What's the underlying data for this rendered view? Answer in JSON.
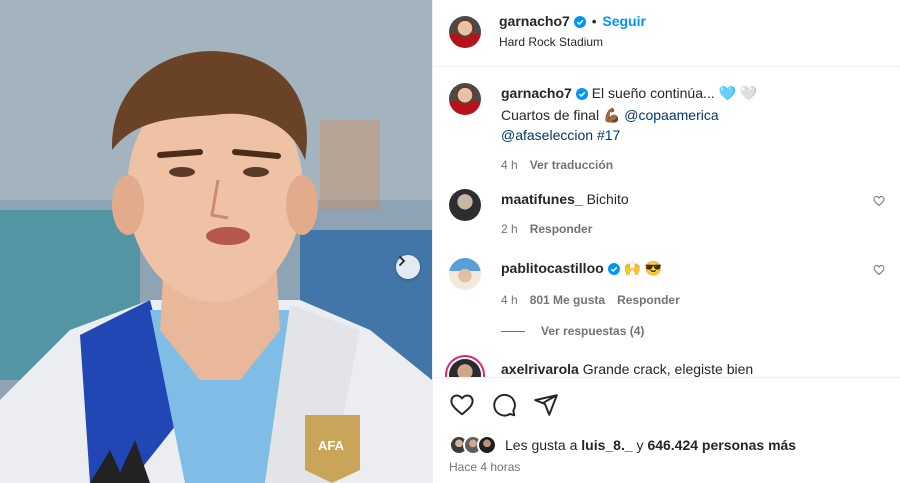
{
  "header": {
    "username": "garnacho7",
    "follow_label": "Seguir",
    "location": "Hard Rock Stadium"
  },
  "caption": {
    "username": "garnacho7",
    "line1": "El sueño continúa... 🩵 🤍",
    "line2_text": "Cuartos de final 💪🏾 ",
    "line2_tag": "@copaamerica",
    "line3_tag": "@afaseleccion",
    "line3_hashtag": "#17",
    "time": "4 h",
    "translate_label": "Ver traducción"
  },
  "comments": [
    {
      "username": "maatifunes_",
      "text": "Bichito",
      "time": "2 h",
      "reply_label": "Responder"
    },
    {
      "username": "pablitocastilloo",
      "text": "🙌 😎",
      "time": "4 h",
      "likes": "801 Me gusta",
      "reply_label": "Responder",
      "view_replies": "Ver respuestas (4)"
    },
    {
      "username": "axelrivarola",
      "text": "Grande crack, elegiste bien"
    }
  ],
  "footer": {
    "likes_prefix": "Les gusta a ",
    "likes_user": "luis_8._",
    "likes_mid": " y ",
    "likes_count": "646.424 personas más",
    "timestamp": "Hace 4 horas"
  },
  "icons": {
    "verified": "verified-badge-icon",
    "heart": "heart-icon",
    "comment": "comment-icon",
    "share": "share-icon",
    "next": "chevron-right-icon"
  },
  "colors": {
    "accent": "#0095f6",
    "link": "#00376b",
    "muted": "#737373"
  }
}
